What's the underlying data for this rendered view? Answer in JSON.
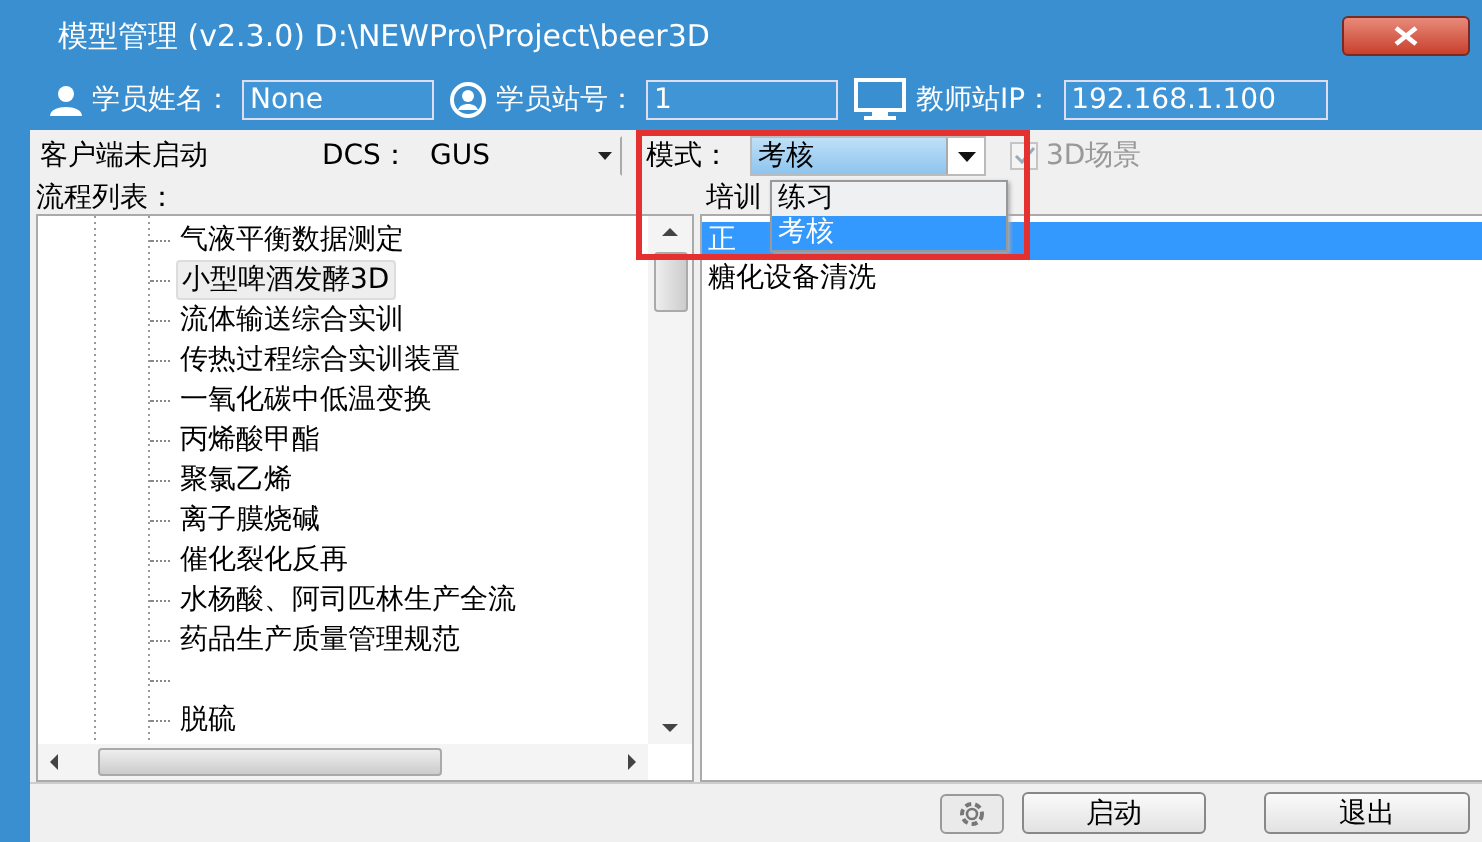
{
  "window": {
    "title": "模型管理 (v2.3.0) D:\\NEWPro\\Project\\beer3D"
  },
  "student": [
    {
      "kind": "person",
      "label": "学员姓名：",
      "value": "None"
    },
    {
      "kind": "station",
      "label": "学员站号：",
      "value": "1"
    },
    {
      "kind": "monitor",
      "label": "教师站IP：",
      "value": "192.168.1.100"
    }
  ],
  "toolbar": {
    "status": "客户端未启动",
    "dcs": {
      "label": "DCS：",
      "value": "GUS"
    },
    "mode": {
      "label": "模式：",
      "value": "考核",
      "expanded": true,
      "options": [
        {
          "label": "练习",
          "selected": false
        },
        {
          "label": "考核",
          "selected": true
        }
      ]
    },
    "scene_3d": {
      "label": "3D场景",
      "checked": true,
      "disabled": true
    }
  },
  "tree": {
    "heading": "流程列表：",
    "items": [
      {
        "kind": "entry",
        "label": "气液平衡数据测定",
        "selected": false
      },
      {
        "kind": "entry",
        "label": "小型啤酒发酵3D",
        "selected": true
      },
      {
        "kind": "entry",
        "label": "流体输送综合实训",
        "selected": false
      },
      {
        "kind": "entry",
        "label": "传热过程综合实训装置",
        "selected": false
      },
      {
        "kind": "entry",
        "label": "一氧化碳中低温变换",
        "selected": false
      },
      {
        "kind": "entry",
        "label": "丙烯酸甲酯",
        "selected": false
      },
      {
        "kind": "entry",
        "label": "聚氯乙烯",
        "selected": false
      },
      {
        "kind": "entry",
        "label": "离子膜烧碱",
        "selected": false
      },
      {
        "kind": "entry",
        "label": "催化裂化反再",
        "selected": false
      },
      {
        "kind": "entry",
        "label": "水杨酸、阿司匹林生产全流",
        "selected": false
      },
      {
        "kind": "entry",
        "label": "药品生产质量管理规范",
        "selected": false
      },
      {
        "kind": "blank"
      },
      {
        "kind": "entry",
        "label": "脱硫",
        "selected": false
      }
    ]
  },
  "training": {
    "heading": "培训",
    "rows": [
      {
        "label": "正",
        "selected": true
      },
      {
        "label": "糖化设备清洗",
        "selected": false
      }
    ]
  },
  "buttons": [
    {
      "label": "启动"
    },
    {
      "label": "退出"
    }
  ],
  "highlight": {
    "kind": "rectangle"
  }
}
